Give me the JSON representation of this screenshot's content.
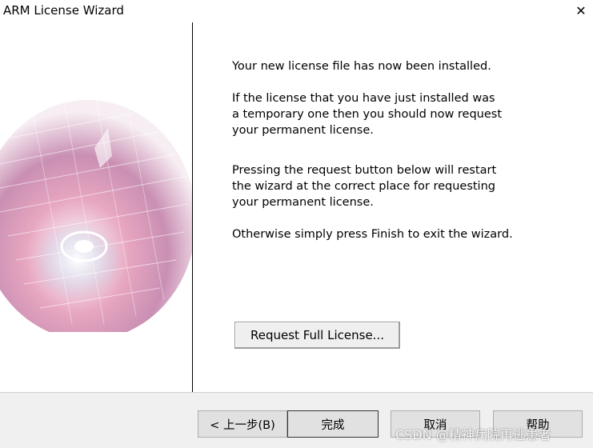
{
  "window": {
    "title": "ARM License Wizard",
    "close_glyph": "✕"
  },
  "main": {
    "para1": "Your new license file has now been installed.",
    "para2": "If the license that you have just installed was\na temporary one then you should now request\nyour permanent license.",
    "para3": "Pressing the request button below will restart\nthe wizard at the correct place for requesting\nyour permanent license.",
    "para4": "Otherwise simply press Finish to exit the wizard.",
    "request_button": "Request Full License..."
  },
  "footer": {
    "back": "< 上一步(B)",
    "finish": "完成",
    "cancel": "取消",
    "help": "帮助"
  },
  "watermark": "CSDN @精神病院再逃患者",
  "colors": {
    "art_pink": "#e8a3bb",
    "art_blue": "#9fb6d6",
    "bottom_bar": "#f0f0f0",
    "button_face": "#e1e1e1"
  }
}
